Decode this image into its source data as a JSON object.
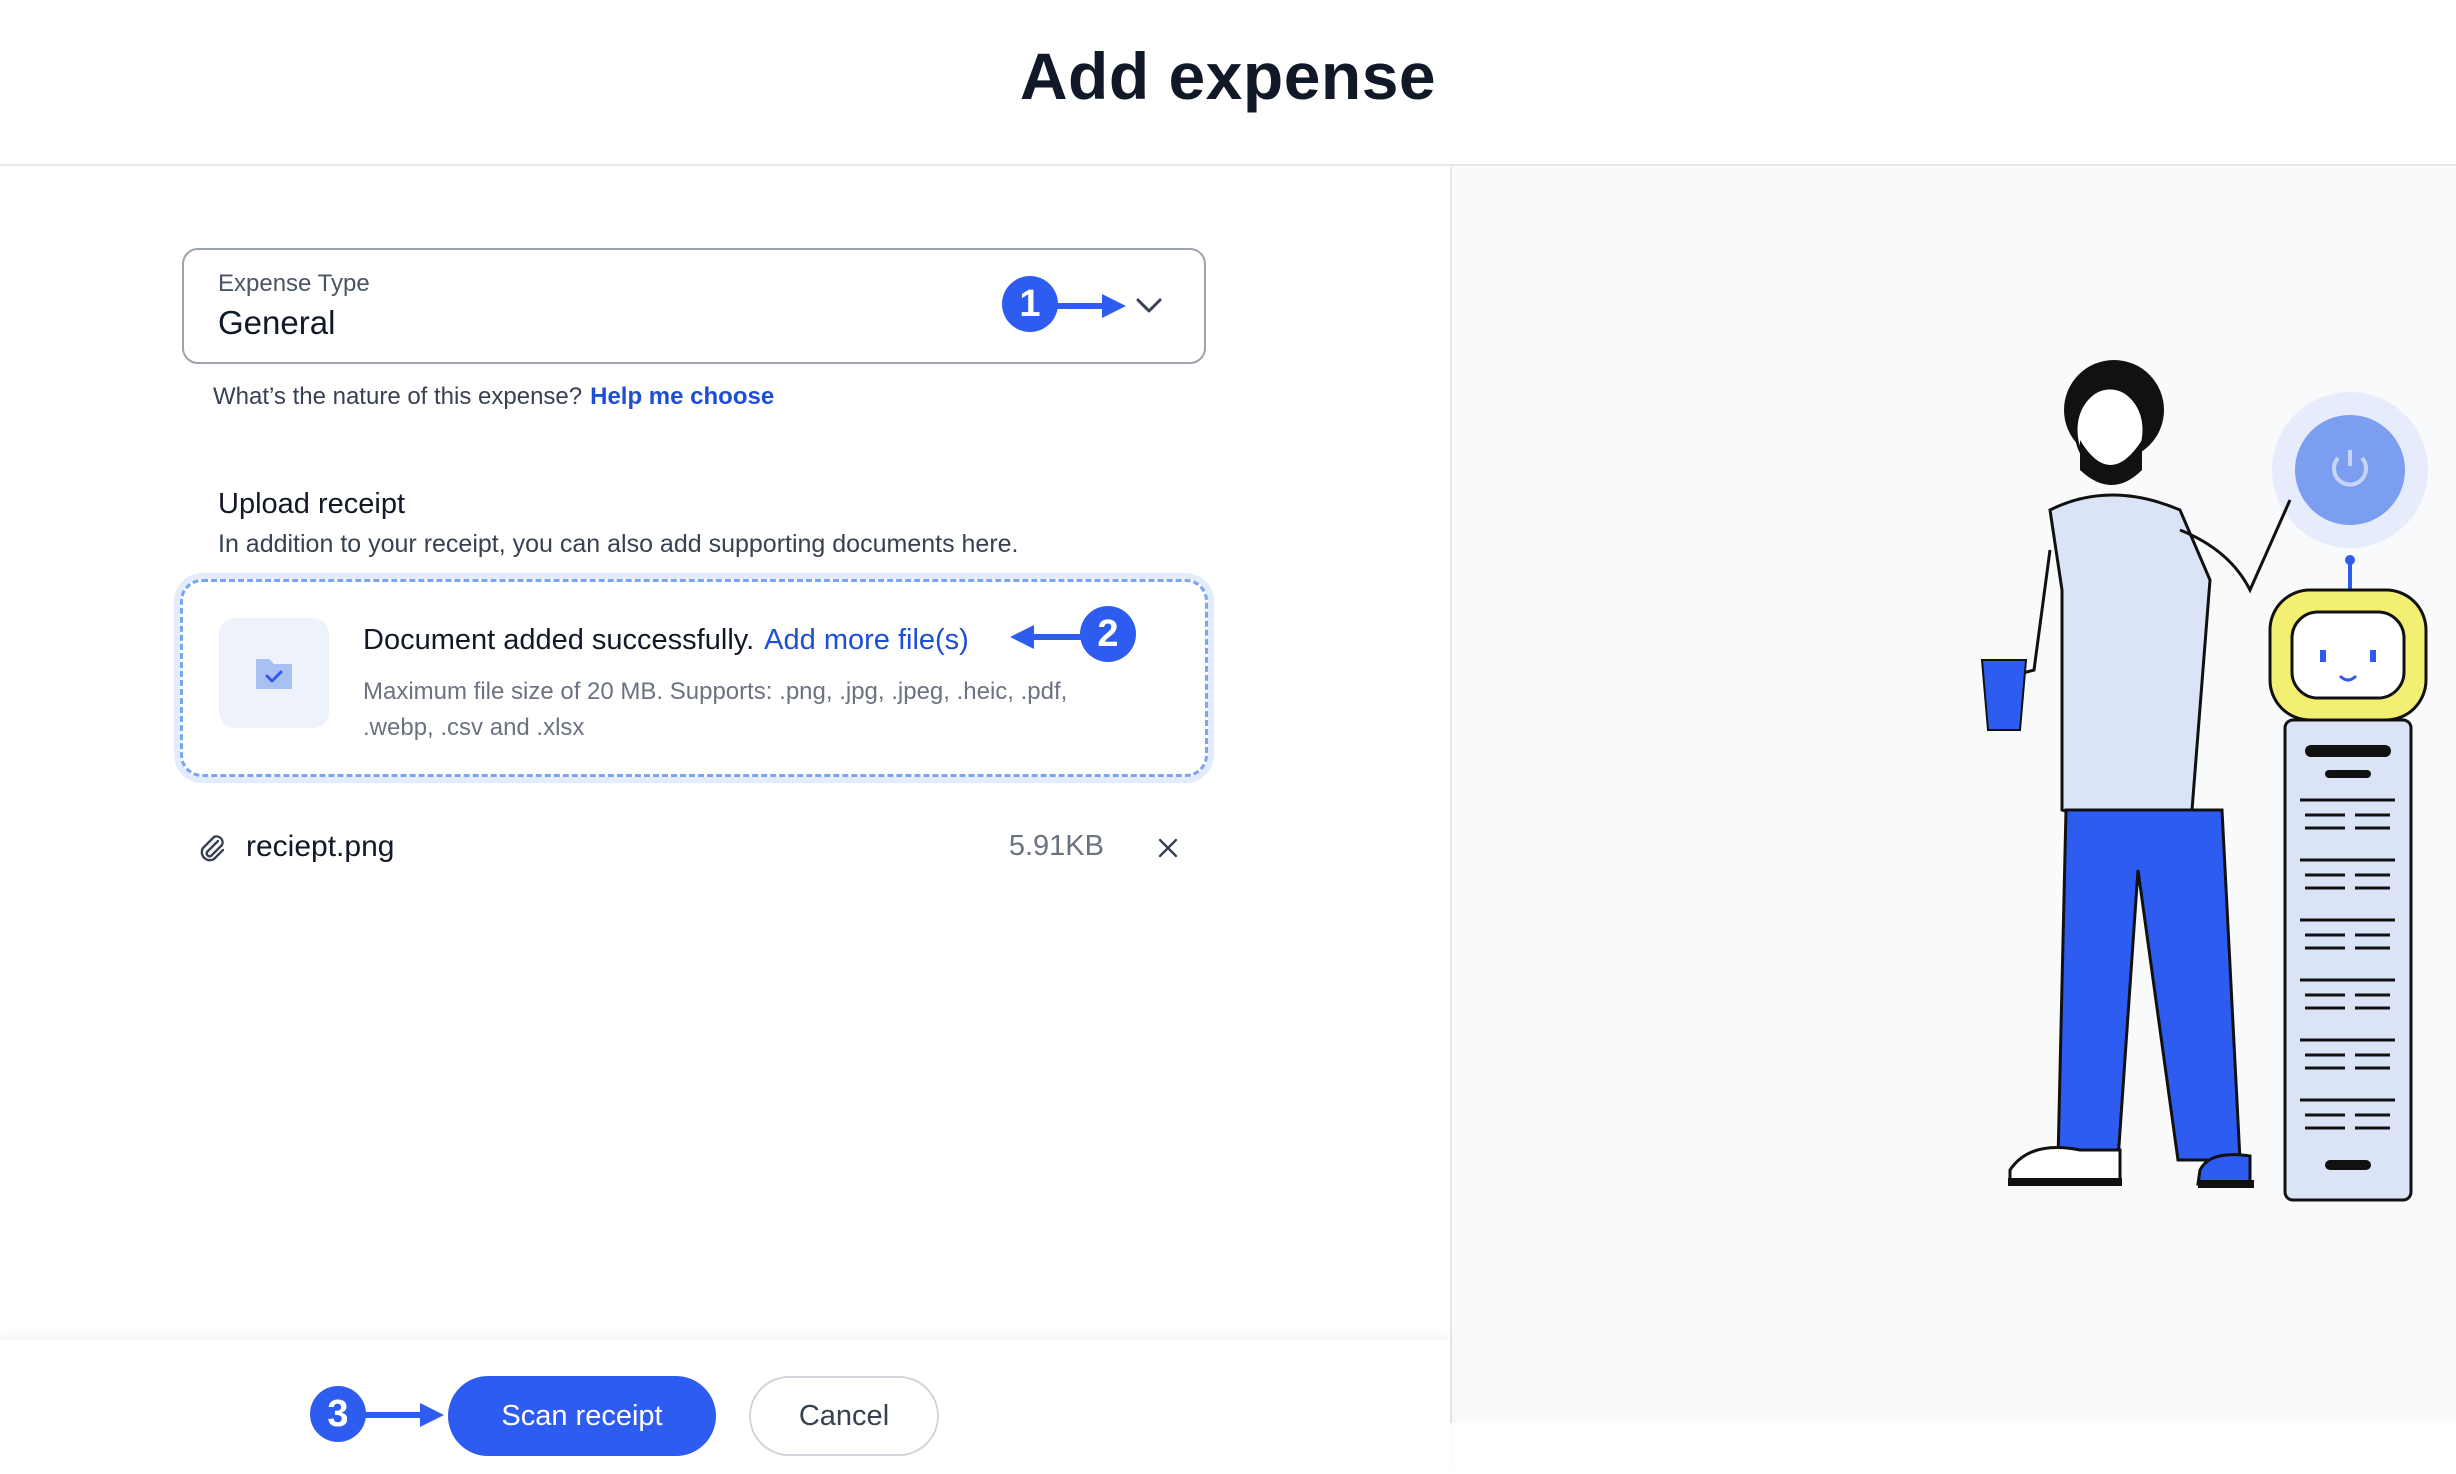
{
  "header": {
    "title": "Add expense"
  },
  "expense_type": {
    "label": "Expense Type",
    "value": "General",
    "hint": "What’s the nature of this expense?",
    "hint_link": "Help me choose"
  },
  "upload": {
    "title": "Upload receipt",
    "subtitle": "In addition to your receipt, you can also add supporting documents here.",
    "status": "Document added successfully.",
    "add_more": "Add more file(s)",
    "note": "Maximum file size of 20 MB. Supports: .png, .jpg, .jpeg, .heic, .pdf, .webp, .csv and .xlsx"
  },
  "file": {
    "name": "reciept.png",
    "size": "5.91KB"
  },
  "footer": {
    "scan_label": "Scan receipt",
    "cancel_label": "Cancel"
  },
  "annotations": [
    "1",
    "2",
    "3"
  ],
  "colors": {
    "accent": "#2f5cf0",
    "link": "#1d4ed8",
    "border": "#9ca3af"
  },
  "icons": [
    "chevron-down-icon",
    "folder-check-icon",
    "paperclip-icon",
    "close-icon"
  ]
}
